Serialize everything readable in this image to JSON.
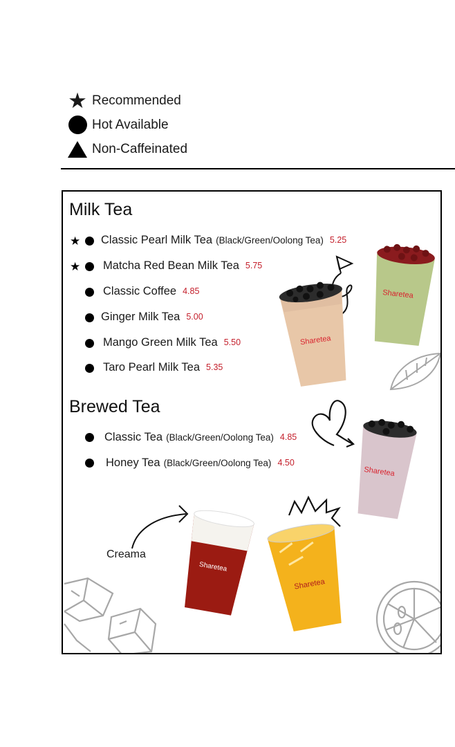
{
  "legend": {
    "recommended": "Recommended",
    "hot_available": "Hot Available",
    "non_caffeinated": "Non-Caffeinated"
  },
  "menu": {
    "sections": [
      {
        "title": "Milk Tea",
        "items": [
          {
            "name": "Classic Pearl Milk Tea",
            "sub": "(Black/Green/Oolong Tea)",
            "price": "5.25",
            "recommended": true,
            "hot": true
          },
          {
            "name": "Matcha Red Bean Milk Tea",
            "price": "5.75",
            "recommended": true,
            "hot": true
          },
          {
            "name": "Classic Coffee",
            "price": "4.85",
            "hot": true
          },
          {
            "name": "Ginger Milk Tea",
            "price": "5.00",
            "hot": true
          },
          {
            "name": "Mango Green Milk Tea",
            "price": "5.50",
            "hot": true
          },
          {
            "name": "Taro Pearl Milk Tea",
            "price": "5.35",
            "hot": true
          }
        ]
      },
      {
        "title": "Brewed Tea",
        "items": [
          {
            "name": "Classic Tea",
            "sub": "(Black/Green/Oolong Tea)",
            "price": "4.85",
            "hot": true
          },
          {
            "name": "Honey Tea",
            "sub": "(Black/Green/Oolong Tea)",
            "price": "4.50",
            "hot": true
          }
        ]
      }
    ]
  },
  "annotation": {
    "creama": "Creama"
  },
  "brand": {
    "logo_text": "Sharetea"
  },
  "colors": {
    "price": "#c4202c",
    "brand_red": "#d9232e",
    "ink": "#000000"
  }
}
